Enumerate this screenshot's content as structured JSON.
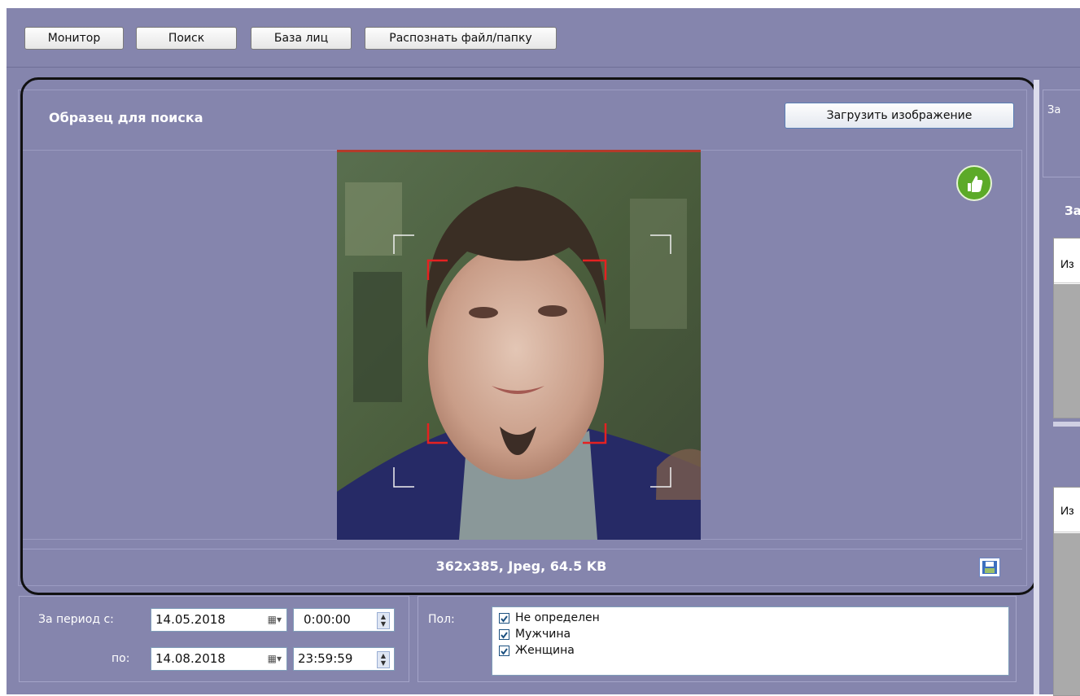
{
  "toolbar": {
    "buttons": [
      "Монитор",
      "Поиск",
      "База лиц",
      "Распознать файл/папку"
    ]
  },
  "sample": {
    "title": "Образец для поиска",
    "load_button": "Загрузить изображение",
    "image_info": "362x385, Jpeg, 64.5 KB",
    "status_icon": "thumbs-up-icon"
  },
  "period": {
    "from_label": "За период с:",
    "from_date": "14.05.2018",
    "from_time": "0:00:00",
    "to_label": "по:",
    "to_date": "14.08.2018",
    "to_time": "23:59:59"
  },
  "gender": {
    "label": "Пол:",
    "options": [
      {
        "label": "Не определен",
        "checked": true
      },
      {
        "label": "Мужчина",
        "checked": true
      },
      {
        "label": "Женщина",
        "checked": true
      }
    ]
  },
  "right_panel": {
    "top_label": "За",
    "section_label": "За",
    "header1": "Из",
    "header2": "Из"
  },
  "colors": {
    "background": "#8585ad",
    "accent": "#5caa28",
    "face_frame": "#e52121"
  }
}
